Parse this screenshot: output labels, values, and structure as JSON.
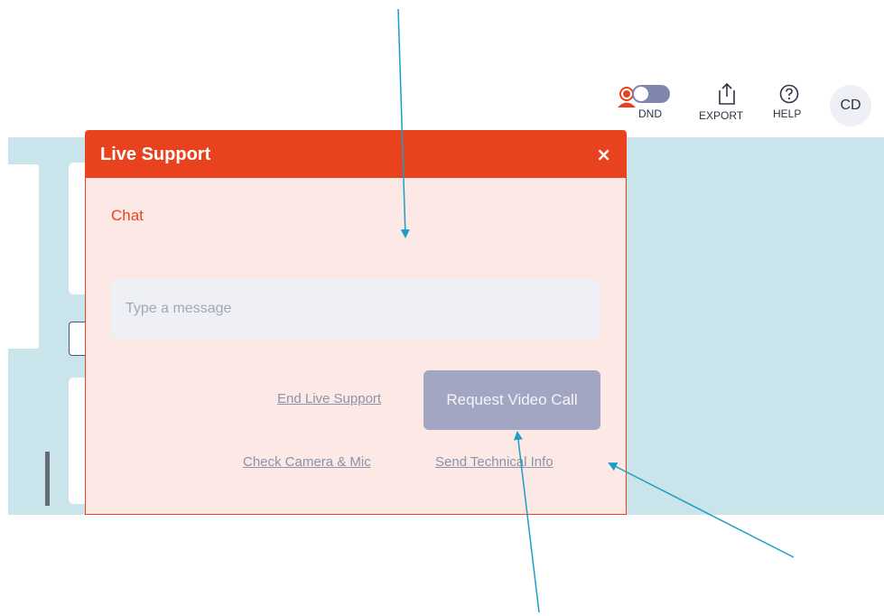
{
  "topbar": {
    "dnd_label": "DND",
    "export_label": "EXPORT",
    "help_label": "HELP",
    "avatar_initials": "CD",
    "icons": [
      "agent-status-icon",
      "dnd-toggle",
      "export-icon",
      "help-icon"
    ]
  },
  "modal": {
    "title": "Live Support",
    "close_label": "×",
    "chat_label": "Chat",
    "input_placeholder": "Type a message",
    "input_value": "",
    "end_live_support_label": "End Live Support",
    "request_video_call_label": "Request Video Call",
    "check_camera_mic_label": "Check Camera & Mic",
    "send_technical_info_label": "Send Technical Info"
  },
  "colors": {
    "accent": "#e8421f",
    "modal_background": "#fce8e4",
    "workspace_background": "#c9e4ea",
    "button_disabled": "#a3a6c2",
    "link": "#8c93ab",
    "annotation_arrow": "#1aa0c8"
  },
  "dnd_enabled": false
}
